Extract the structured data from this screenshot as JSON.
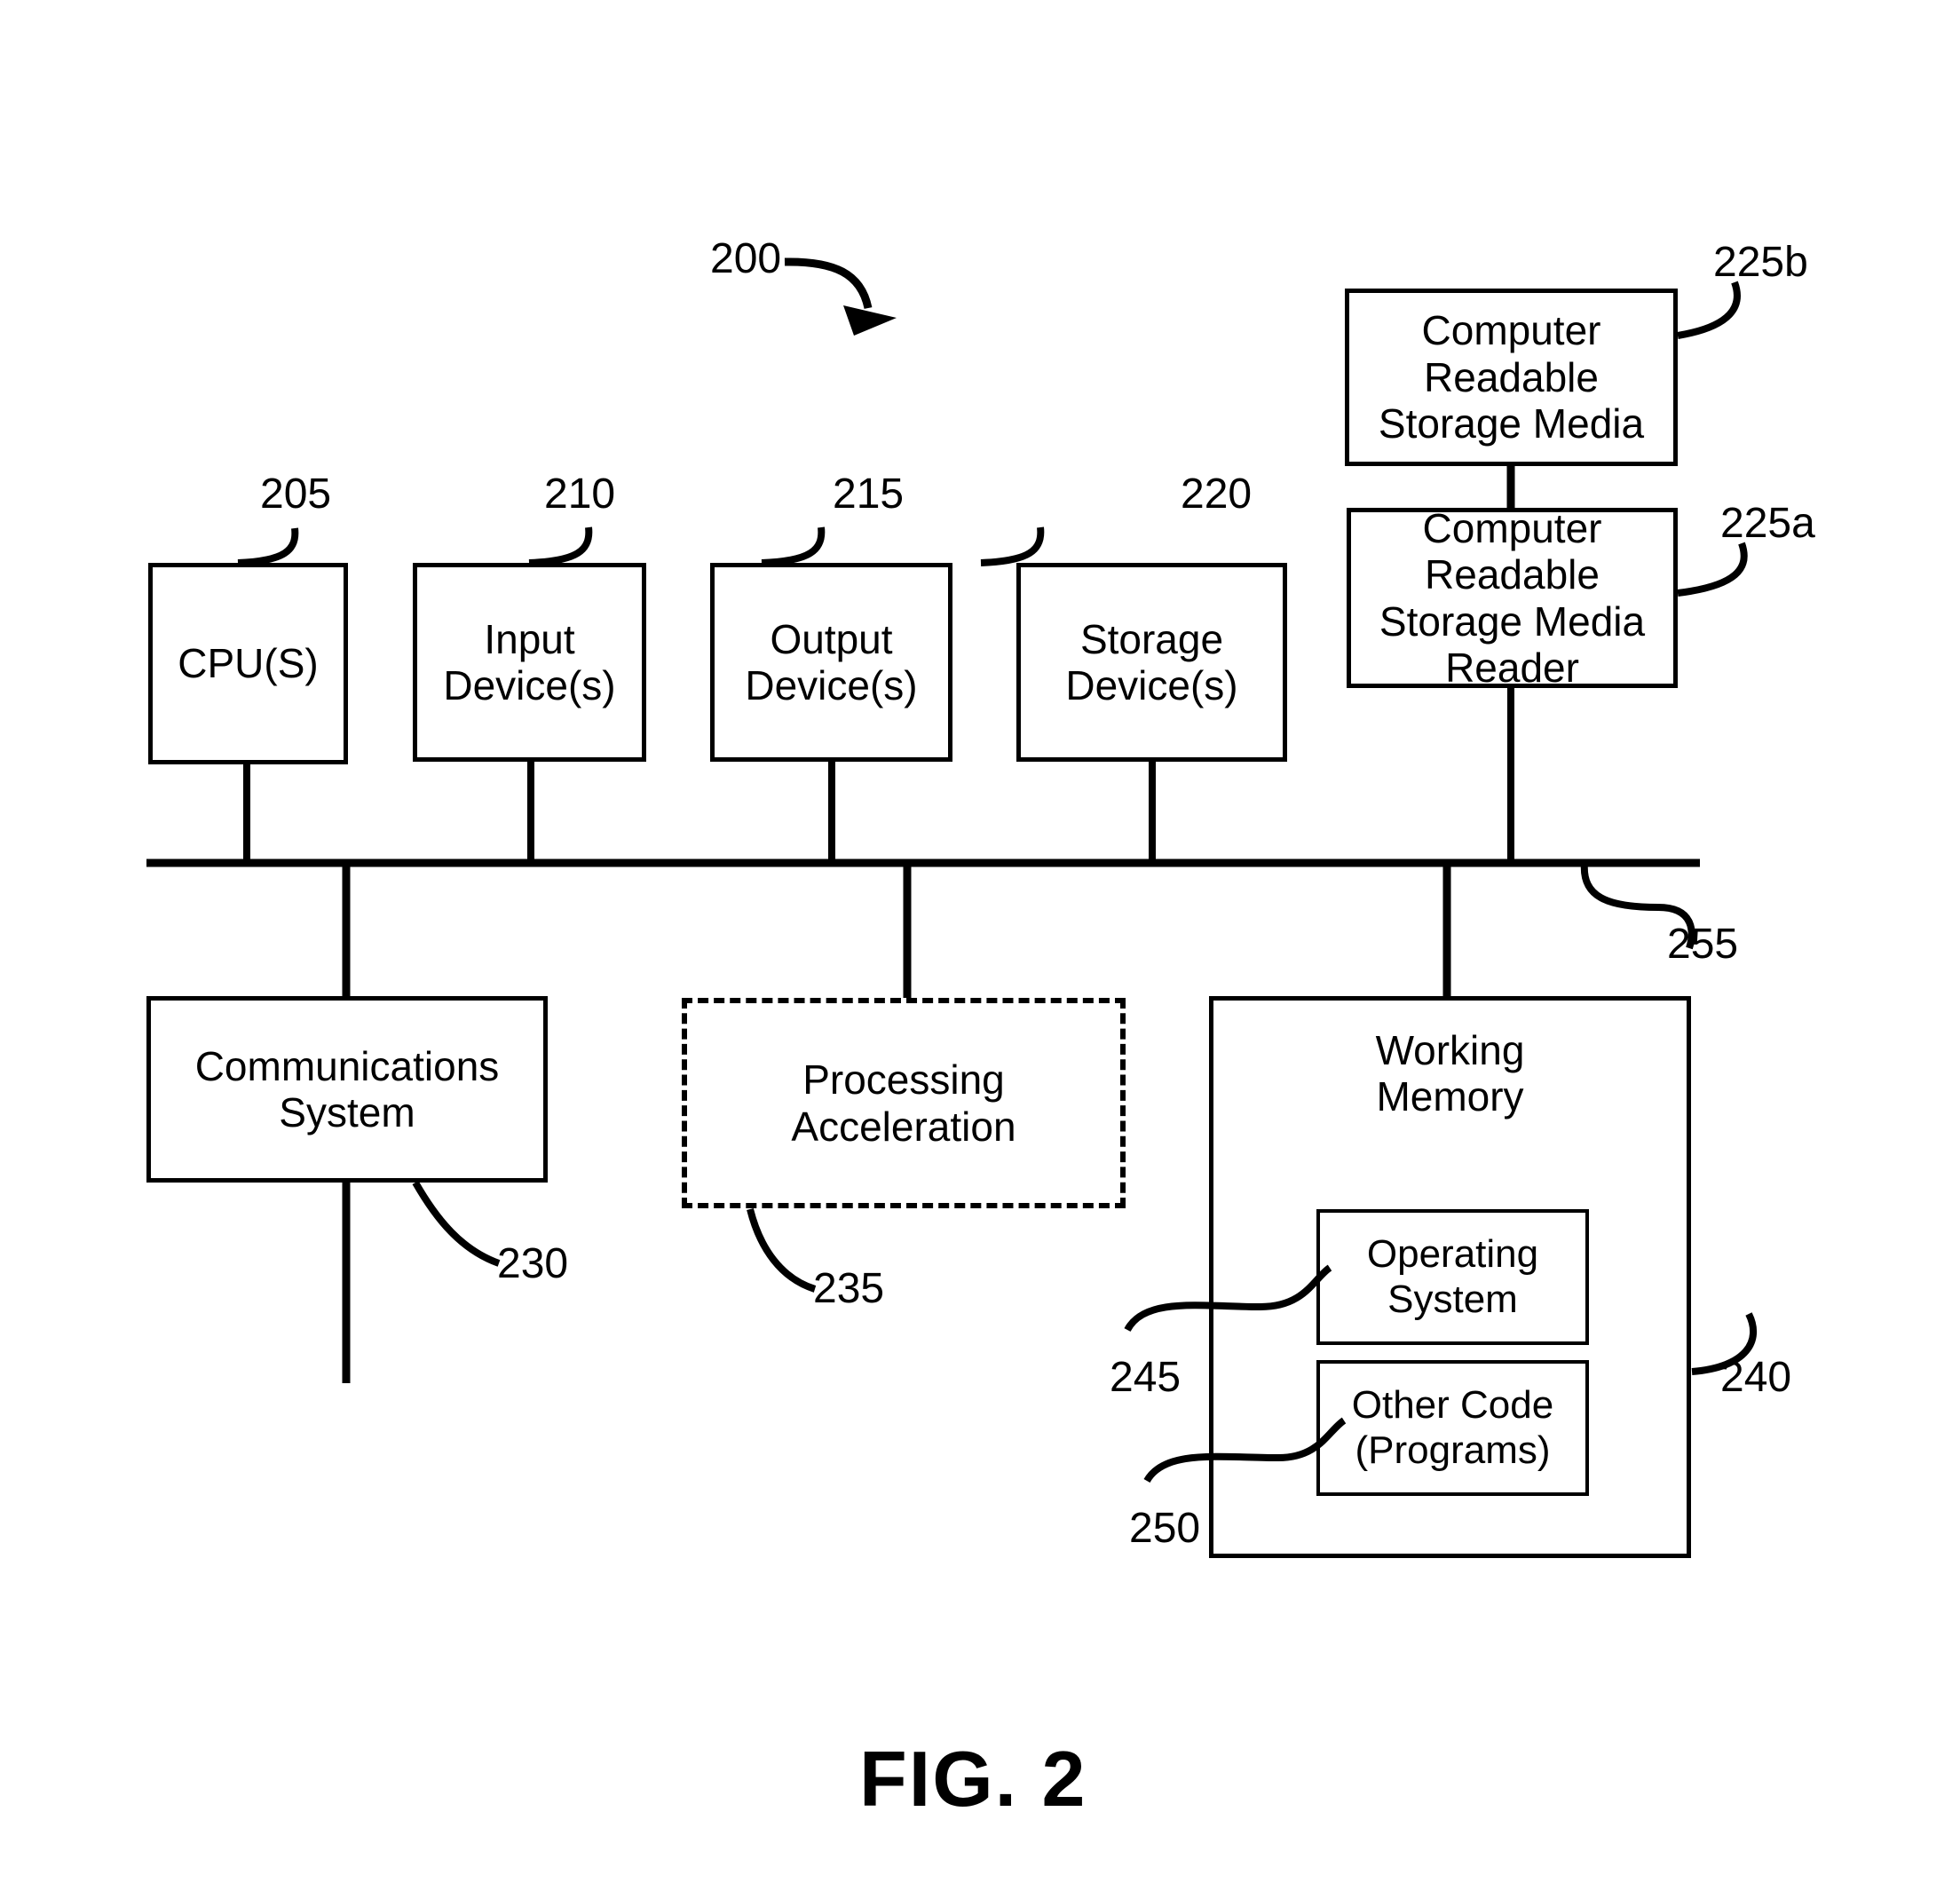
{
  "figure": {
    "caption": "FIG. 2",
    "system_ref": "200"
  },
  "nodes": [
    {
      "id": "cpu",
      "label": "CPU(S)",
      "ref": "205"
    },
    {
      "id": "input_devices",
      "label": "Input\nDevice(s)",
      "ref": "210"
    },
    {
      "id": "output_devices",
      "label": "Output\nDevice(s)",
      "ref": "215"
    },
    {
      "id": "storage_devices",
      "label": "Storage\nDevice(s)",
      "ref": "220"
    },
    {
      "id": "crsm",
      "label": "Computer\nReadable\nStorage Media",
      "ref": "225b"
    },
    {
      "id": "crsm_reader",
      "label": "Computer\nReadable\nStorage Media\nReader",
      "ref": "225a"
    },
    {
      "id": "comm_system",
      "label": "Communications\nSystem",
      "ref": "230"
    },
    {
      "id": "proc_accel",
      "label": "Processing\nAcceleration",
      "ref": "235"
    },
    {
      "id": "working_memory",
      "label": "Working\nMemory",
      "ref": "240"
    },
    {
      "id": "operating_system",
      "label": "Operating\nSystem",
      "ref": "245"
    },
    {
      "id": "other_code",
      "label": "Other Code\n(Programs)",
      "ref": "250"
    },
    {
      "id": "bus",
      "label": "",
      "ref": "255"
    }
  ],
  "colors": {
    "stroke": "#000000",
    "background": "#ffffff"
  }
}
